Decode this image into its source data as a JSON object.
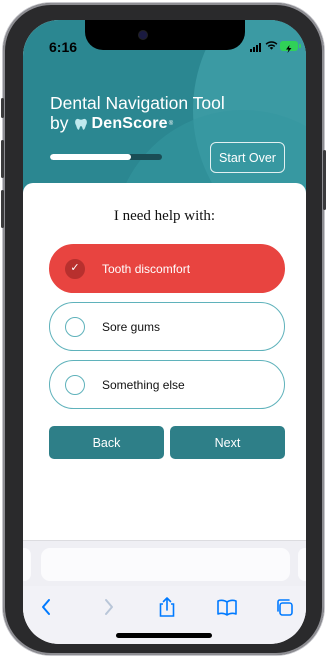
{
  "status_bar": {
    "time": "6:16"
  },
  "header": {
    "title": "Dental Navigation Tool",
    "by_text": "by",
    "brand_name": "DenScore",
    "brand_tm": "®",
    "progress_fraction": 0.72,
    "start_over_label": "Start Over"
  },
  "question": {
    "text": "I need help with:"
  },
  "options": [
    {
      "label": "Tooth discomfort",
      "selected": true
    },
    {
      "label": "Sore gums",
      "selected": false
    },
    {
      "label": "Something else",
      "selected": false
    }
  ],
  "navigation": {
    "back_label": "Back",
    "next_label": "Next"
  },
  "toolbar": {
    "icons": [
      "back-arrow-icon",
      "forward-arrow-icon",
      "share-icon",
      "bookmarks-icon",
      "tabs-icon"
    ]
  },
  "colors": {
    "header_teal": "#2b8791",
    "selected_red": "#e84440",
    "button_teal": "#2e7f88",
    "option_border": "#5fb2bb",
    "ios_blue": "#007aff"
  }
}
